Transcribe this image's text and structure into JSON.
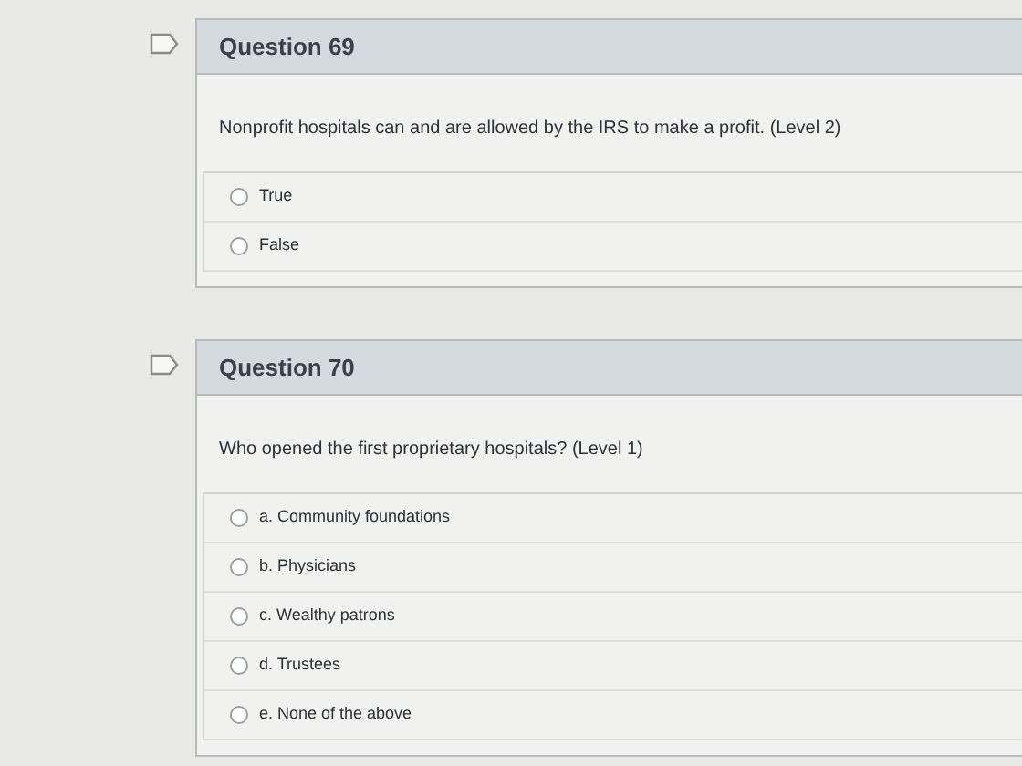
{
  "questions": [
    {
      "title": "Question 69",
      "prompt": "Nonprofit hospitals can and are allowed by the IRS to make a profit. (Level 2)",
      "options": [
        {
          "label": "True",
          "selected": false
        },
        {
          "label": "False",
          "selected": false
        }
      ]
    },
    {
      "title": "Question 70",
      "prompt": "Who opened the first proprietary hospitals? (Level 1)",
      "options": [
        {
          "label": "a. Community foundations",
          "selected": false
        },
        {
          "label": "b. Physicians",
          "selected": false
        },
        {
          "label": "c. Wealthy patrons",
          "selected": false
        },
        {
          "label": "d. Trustees",
          "selected": false
        },
        {
          "label": "e. None of the above",
          "selected": false
        }
      ]
    }
  ]
}
